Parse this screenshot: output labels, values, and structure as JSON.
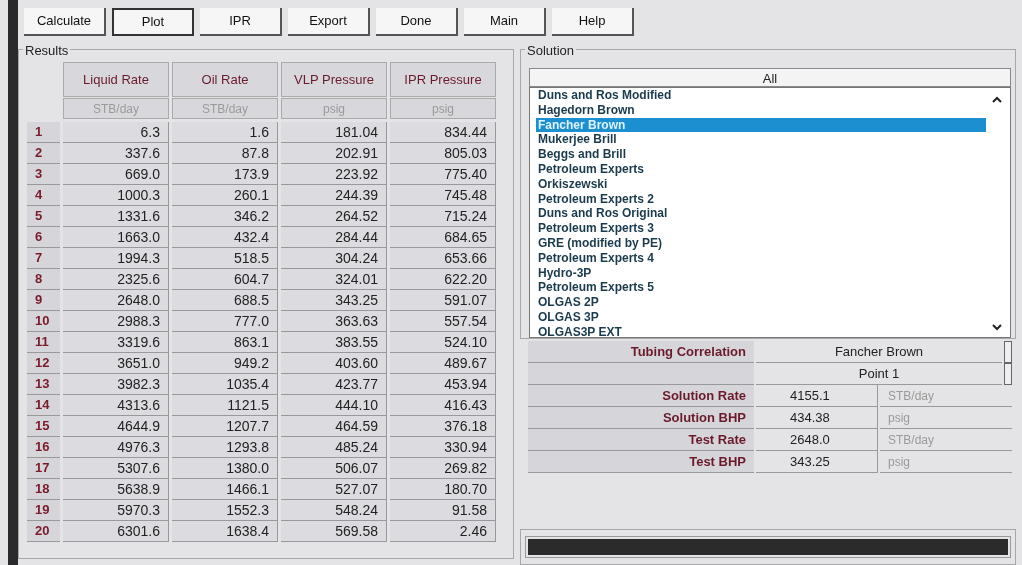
{
  "toolbar": [
    {
      "label": "Calculate",
      "selected": false
    },
    {
      "label": "Plot",
      "selected": true
    },
    {
      "label": "IPR",
      "selected": false
    },
    {
      "label": "Export",
      "selected": false
    },
    {
      "label": "Done",
      "selected": false
    },
    {
      "label": "Main",
      "selected": false
    },
    {
      "label": "Help",
      "selected": false
    }
  ],
  "results": {
    "title": "Results",
    "columns": [
      {
        "name": "Liquid Rate",
        "unit": "STB/day"
      },
      {
        "name": "Oil Rate",
        "unit": "STB/day"
      },
      {
        "name": "VLP Pressure",
        "unit": "psig"
      },
      {
        "name": "IPR Pressure",
        "unit": "psig"
      }
    ],
    "rows": [
      {
        "index": "1",
        "cells": [
          "6.3",
          "1.6",
          "181.04",
          "834.44"
        ]
      },
      {
        "index": "2",
        "cells": [
          "337.6",
          "87.8",
          "202.91",
          "805.03"
        ]
      },
      {
        "index": "3",
        "cells": [
          "669.0",
          "173.9",
          "223.92",
          "775.40"
        ]
      },
      {
        "index": "4",
        "cells": [
          "1000.3",
          "260.1",
          "244.39",
          "745.48"
        ]
      },
      {
        "index": "5",
        "cells": [
          "1331.6",
          "346.2",
          "264.52",
          "715.24"
        ]
      },
      {
        "index": "6",
        "cells": [
          "1663.0",
          "432.4",
          "284.44",
          "684.65"
        ]
      },
      {
        "index": "7",
        "cells": [
          "1994.3",
          "518.5",
          "304.24",
          "653.66"
        ]
      },
      {
        "index": "8",
        "cells": [
          "2325.6",
          "604.7",
          "324.01",
          "622.20"
        ]
      },
      {
        "index": "9",
        "cells": [
          "2648.0",
          "688.5",
          "343.25",
          "591.07"
        ]
      },
      {
        "index": "10",
        "cells": [
          "2988.3",
          "777.0",
          "363.63",
          "557.54"
        ]
      },
      {
        "index": "11",
        "cells": [
          "3319.6",
          "863.1",
          "383.55",
          "524.10"
        ]
      },
      {
        "index": "12",
        "cells": [
          "3651.0",
          "949.2",
          "403.60",
          "489.67"
        ]
      },
      {
        "index": "13",
        "cells": [
          "3982.3",
          "1035.4",
          "423.77",
          "453.94"
        ]
      },
      {
        "index": "14",
        "cells": [
          "4313.6",
          "1121.5",
          "444.10",
          "416.43"
        ]
      },
      {
        "index": "15",
        "cells": [
          "4644.9",
          "1207.7",
          "464.59",
          "376.18"
        ]
      },
      {
        "index": "16",
        "cells": [
          "4976.3",
          "1293.8",
          "485.24",
          "330.94"
        ]
      },
      {
        "index": "17",
        "cells": [
          "5307.6",
          "1380.0",
          "506.07",
          "269.82"
        ]
      },
      {
        "index": "18",
        "cells": [
          "5638.9",
          "1466.1",
          "527.07",
          "180.70"
        ]
      },
      {
        "index": "19",
        "cells": [
          "5970.3",
          "1552.3",
          "548.24",
          "91.58"
        ]
      },
      {
        "index": "20",
        "cells": [
          "6301.6",
          "1638.4",
          "569.58",
          "2.46"
        ]
      }
    ]
  },
  "solution": {
    "title": "Solution",
    "all_button": "All",
    "correlations": [
      {
        "label": "Duns and Ros Modified",
        "selected": false
      },
      {
        "label": "Hagedorn Brown",
        "selected": false
      },
      {
        "label": "Fancher Brown",
        "selected": true
      },
      {
        "label": "Mukerjee Brill",
        "selected": false
      },
      {
        "label": "Beggs and Brill",
        "selected": false
      },
      {
        "label": "Petroleum Experts",
        "selected": false
      },
      {
        "label": "Orkiszewski",
        "selected": false
      },
      {
        "label": "Petroleum Experts 2",
        "selected": false
      },
      {
        "label": "Duns and Ros Original",
        "selected": false
      },
      {
        "label": "Petroleum Experts 3",
        "selected": false
      },
      {
        "label": "GRE (modified by PE)",
        "selected": false
      },
      {
        "label": "Petroleum Experts 4",
        "selected": false
      },
      {
        "label": "Hydro-3P",
        "selected": false
      },
      {
        "label": "Petroleum Experts 5",
        "selected": false
      },
      {
        "label": "OLGAS 2P",
        "selected": false
      },
      {
        "label": "OLGAS 3P",
        "selected": false
      },
      {
        "label": "OLGAS3P EXT",
        "selected": false
      }
    ],
    "tubing_correlation": {
      "label": "Tubing Correlation",
      "value": "Fancher Brown"
    },
    "point": {
      "value": "Point 1"
    },
    "fields": [
      {
        "label": "Solution Rate",
        "value": "4155.1",
        "unit": "STB/day"
      },
      {
        "label": "Solution BHP",
        "value": "434.38",
        "unit": "psig"
      },
      {
        "label": "Test Rate",
        "value": "2648.0",
        "unit": "STB/day"
      },
      {
        "label": "Test BHP",
        "value": "343.25",
        "unit": "psig"
      }
    ]
  },
  "progress": {
    "level": 1
  }
}
